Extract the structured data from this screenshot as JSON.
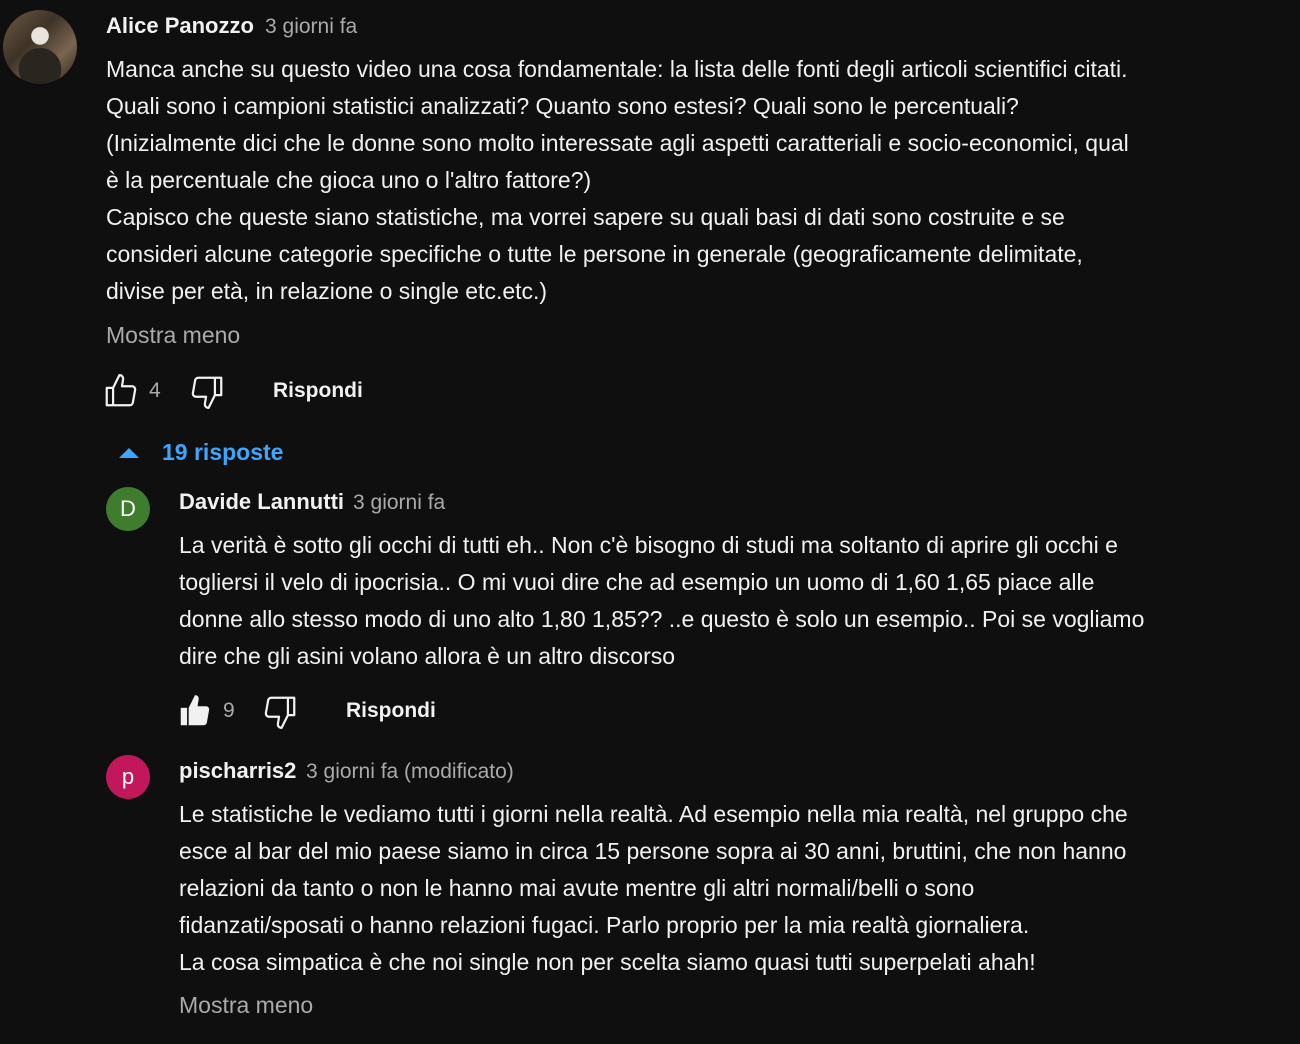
{
  "main_comment": {
    "author": "Alice Panozzo",
    "time": "3 giorni fa",
    "lines": [
      "Manca anche su questo video una cosa fondamentale: la lista delle fonti degli articoli scientifici citati.",
      "Quali sono i campioni statistici analizzati? Quanto sono estesi? Quali sono le percentuali?",
      "(Inizialmente dici che le donne sono molto interessate agli aspetti caratteriali e socio-economici, qual",
      "è la percentuale che gioca uno o l'altro fattore?)",
      "Capisco che queste siano statistiche, ma vorrei sapere su quali basi di dati sono costruite e se",
      "consideri alcune categorie specifiche o tutte le persone in generale (geograficamente delimitate,",
      "divise per età, in relazione o single etc.etc.)"
    ],
    "show_less": "Mostra meno",
    "likes": "4",
    "reply_label": "Rispondi"
  },
  "replies_toggle": "19 risposte",
  "replies": [
    {
      "initial": "D",
      "avatar_color": "#3f7d2e",
      "author": "Davide Lannutti",
      "time": "3 giorni fa",
      "lines": [
        "La verità è sotto gli occhi di tutti eh.. Non c'è bisogno di studi ma soltanto di aprire gli occhi e",
        "togliersi il velo di ipocrisia.. O mi vuoi dire che ad esempio un uomo di 1,60 1,65 piace alle",
        "donne allo stesso modo di uno alto 1,80 1,85?? ..e questo è solo un esempio.. Poi se vogliamo",
        "dire che gli asini volano allora è un altro discorso"
      ],
      "likes": "9",
      "reply_label": "Rispondi"
    },
    {
      "initial": "p",
      "avatar_color": "#c2185b",
      "author": "pischarris2",
      "time": "3 giorni fa (modificato)",
      "lines": [
        "Le statistiche le vediamo tutti i giorni nella realtà. Ad esempio nella mia realtà, nel gruppo che",
        "esce al bar del mio paese siamo in circa 15 persone sopra ai 30 anni, bruttini, che non hanno",
        "relazioni da tanto o non le hanno mai avute mentre gli altri normali/belli o sono",
        "fidanzati/sposati o hanno relazioni fugaci. Parlo proprio per la mia realtà giornaliera.",
        "La cosa simpatica è che noi single non per scelta siamo quasi tutti superpelati ahah!"
      ],
      "show_less": "Mostra meno"
    }
  ]
}
